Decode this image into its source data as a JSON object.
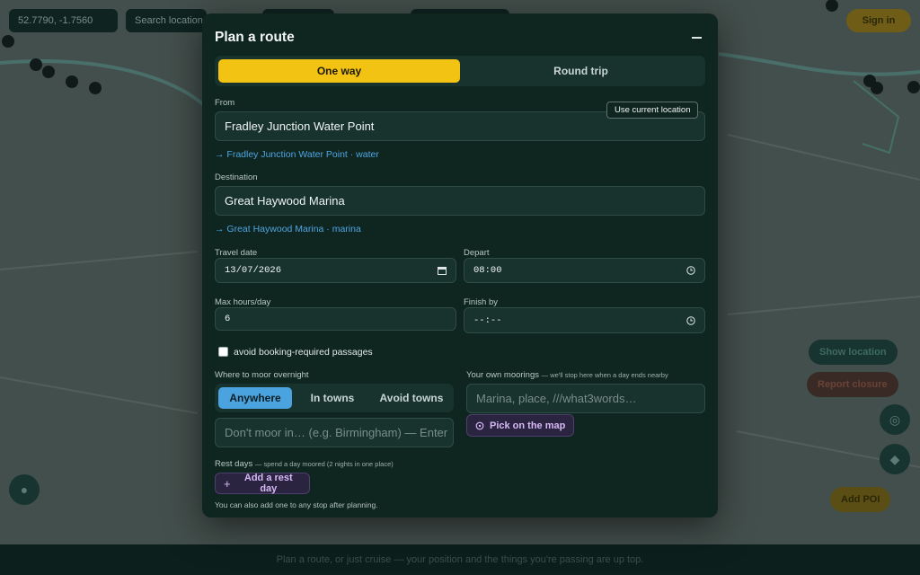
{
  "background": {
    "coords_label": "52.7790, -1.7560",
    "search_hint": "Search location",
    "layer_label": "",
    "mid_label": "",
    "signin_label": "Sign in",
    "show_location_label": "Show location",
    "report_label": "Report closure",
    "add_poi_label": "Add POI",
    "bottom_hint": "Plan a route, or just cruise — your position and the things you're passing are up top."
  },
  "modal": {
    "title": "Plan a route",
    "trip_modes": [
      {
        "label": "One way",
        "active": true
      },
      {
        "label": "Round trip",
        "active": false
      }
    ],
    "from": {
      "label": "From",
      "value": "Fradley Junction Water Point",
      "use_current_location": "Use current location",
      "suggestion": "→ Fradley Junction Water Point · water"
    },
    "destination": {
      "label": "Destination",
      "value": "Great Haywood Marina",
      "suggestion": "→ Great Haywood Marina · marina"
    },
    "travel_date": {
      "label": "Travel date",
      "value": "13/07/2026"
    },
    "depart": {
      "label": "Depart",
      "value": "08:00"
    },
    "max_hours": {
      "label": "Max hours/day",
      "value": "6"
    },
    "finish_by": {
      "label": "Finish by",
      "value": "--:--"
    },
    "avoid_booking": {
      "label": "avoid booking-required passages",
      "checked": false
    },
    "moor": {
      "label": "Where to moor overnight",
      "options": [
        {
          "label": "Anywhere",
          "active": true
        },
        {
          "label": "In towns",
          "active": false
        },
        {
          "label": "Avoid towns",
          "active": false
        }
      ],
      "exclude_placeholder": "Don't moor in… (e.g. Birmingham) — Enter"
    },
    "own_moorings": {
      "label": "Your own moorings",
      "hint": "— we'll stop here when a day ends nearby",
      "placeholder": "Marina, place, ///what3words…",
      "pick_on_map": "Pick on the map"
    },
    "rest_days": {
      "label": "Rest days",
      "hint": "— spend a day moored (2 nights in one place)",
      "add_label": "Add a rest day",
      "note": "You can also add one to any stop after planning."
    }
  },
  "colors": {
    "accent_yellow": "#f2c313",
    "accent_blue": "#4aa3df",
    "link_blue": "#4ea6e2",
    "panel_bg": "#0f2520"
  }
}
